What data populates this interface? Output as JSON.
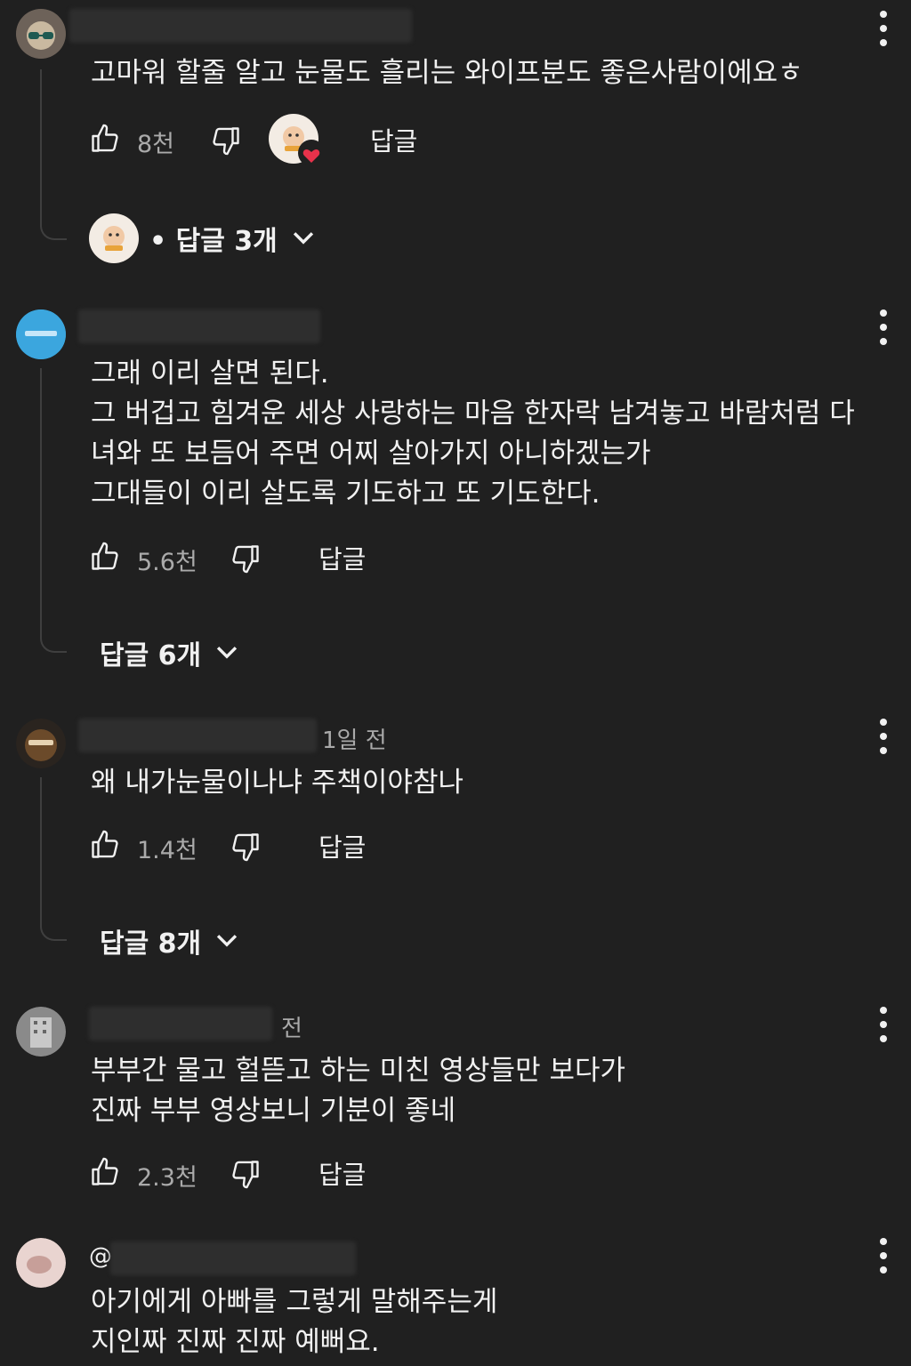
{
  "icons": {
    "like": "thumbs-up-icon",
    "dislike": "thumbs-down-icon",
    "more": "more-vert-icon",
    "expand": "chevron-down-icon",
    "creator_heart": "creator-heart-icon"
  },
  "colors": {
    "background": "#202020",
    "text": "#f1f1f1",
    "muted": "#aaaaaa",
    "heart": "#e8324b"
  },
  "comments": [
    {
      "lines": [
        "고마워 할줄 알고 눈물도 흘리는 와이프분도 좋은사람이에요ㅎ"
      ],
      "likes": "8천",
      "reply_label": "답글",
      "replies_text": "• 답글 3개"
    },
    {
      "lines": [
        "그래 이리 살면 된다.",
        "그 버겁고 힘겨운 세상 사랑하는 마음 한자락 남겨놓고 바람처럼 다",
        "녀와 또 보듬어 주면 어찌 살아가지 아니하겠는가",
        "그대들이 이리 살도록 기도하고 또 기도한다."
      ],
      "likes": "5.6천",
      "reply_label": "답글",
      "replies_text": "답글 6개"
    },
    {
      "time": "1일 전",
      "lines": [
        "왜 내가눈물이나냐 주책이야참나"
      ],
      "likes": "1.4천",
      "reply_label": "답글",
      "replies_text": "답글 8개"
    },
    {
      "time": "전",
      "lines": [
        "부부간 물고 헐뜯고 하는 미친 영상들만 보다가",
        "진짜 부부 영상보니 기분이 좋네"
      ],
      "likes": "2.3천",
      "reply_label": "답글"
    },
    {
      "handle_prefix": "@",
      "lines": [
        "아기에게 아빠를 그렇게 말해주는게",
        "지인짜 진짜 진짜 예뻐요."
      ]
    }
  ]
}
